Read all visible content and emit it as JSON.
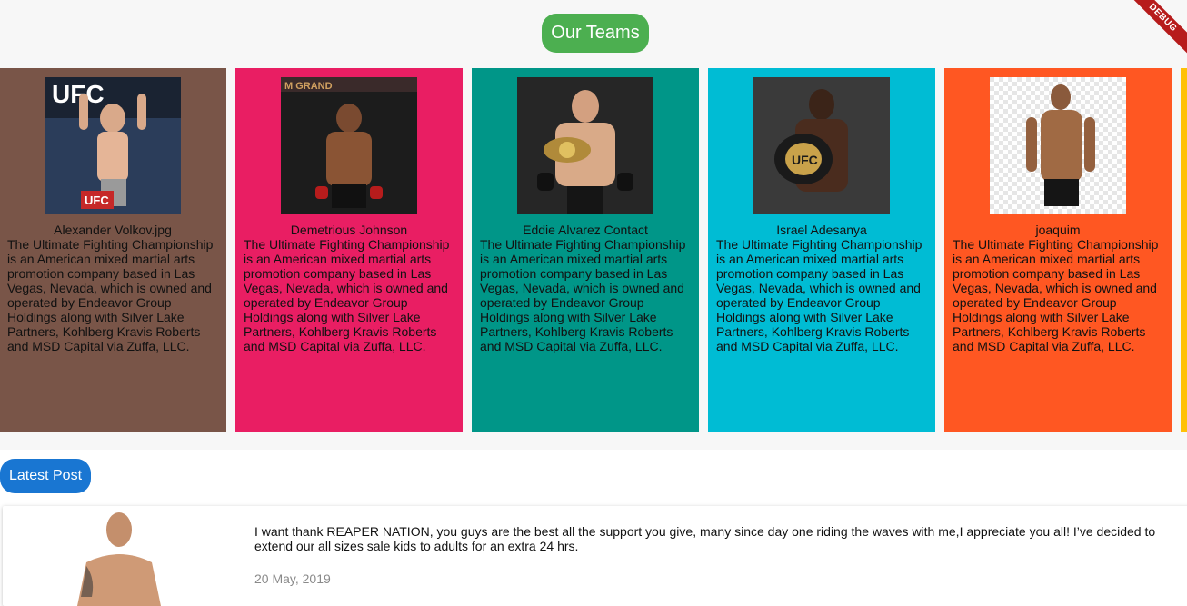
{
  "debug_banner": "DEBUG",
  "teams": {
    "title": "Our Teams",
    "title_color": "#4caf50",
    "members": [
      {
        "name": "Alexander Volkov.jpg",
        "color": "#795548",
        "description": "The Ultimate Fighting Championship is an American mixed martial arts promotion company based in Las Vegas, Nevada, which is owned and operated by Endeavor Group Holdings along with Silver Lake Partners, Kohlberg Kravis Roberts and MSD Capital via Zuffa, LLC."
      },
      {
        "name": "Demetrious Johnson",
        "color": "#e91e63",
        "description": "The Ultimate Fighting Championship is an American mixed martial arts promotion company based in Las Vegas, Nevada, which is owned and operated by Endeavor Group Holdings along with Silver Lake Partners, Kohlberg Kravis Roberts and MSD Capital via Zuffa, LLC."
      },
      {
        "name": "Eddie Alvarez Contact",
        "color": "#009688",
        "description": "The Ultimate Fighting Championship is an American mixed martial arts promotion company based in Las Vegas, Nevada, which is owned and operated by Endeavor Group Holdings along with Silver Lake Partners, Kohlberg Kravis Roberts and MSD Capital via Zuffa, LLC."
      },
      {
        "name": "Israel Adesanya",
        "color": "#00bcd4",
        "description": "The Ultimate Fighting Championship is an American mixed martial arts promotion company based in Las Vegas, Nevada, which is owned and operated by Endeavor Group Holdings along with Silver Lake Partners, Kohlberg Kravis Roberts and MSD Capital via Zuffa, LLC."
      },
      {
        "name": "joaquim",
        "color": "#ff5722",
        "description": "The Ultimate Fighting Championship is an American mixed martial arts promotion company based in Las Vegas, Nevada, which is owned and operated by Endeavor Group Holdings along with Silver Lake Partners, Kohlberg Kravis Roberts and MSD Capital via Zuffa, LLC."
      }
    ],
    "next_card_color": "#ffc107"
  },
  "latest": {
    "badge": "Latest Post",
    "badge_color": "#1976d2",
    "post": {
      "text": "I want thank REAPER NATION, you guys are the best all the support you give, many since day one riding the waves with me,I appreciate you all! I’ve decided to extend our all sizes sale kids to adults for an extra 24 hrs.",
      "date": "20 May, 2019"
    }
  }
}
